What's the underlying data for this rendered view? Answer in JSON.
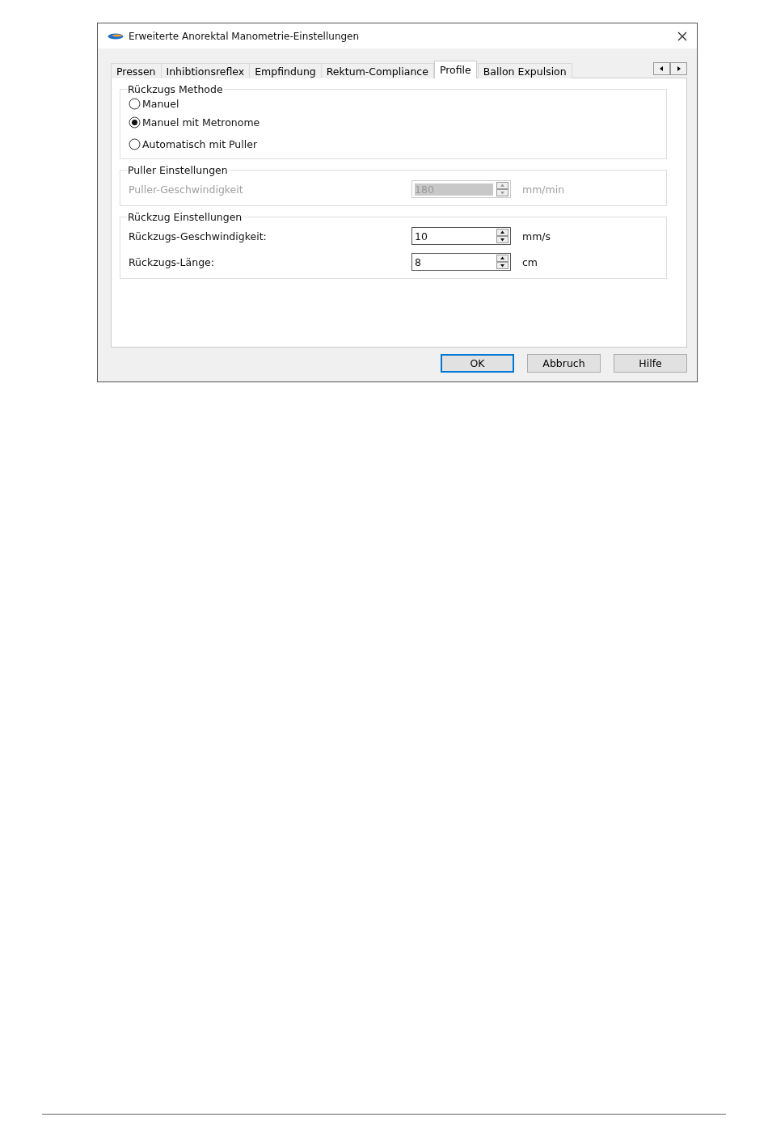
{
  "window": {
    "title": "Erweiterte Anorektal Manometrie-Einstellungen"
  },
  "tabs": [
    {
      "label": "Pressen",
      "selected": false
    },
    {
      "label": "Inhibtionsreflex",
      "selected": false
    },
    {
      "label": "Empfindung",
      "selected": false
    },
    {
      "label": "Rektum-Compliance",
      "selected": false
    },
    {
      "label": "Profile",
      "selected": true
    },
    {
      "label": "Ballon Expulsion",
      "selected": false
    }
  ],
  "groups": [
    {
      "title": "Rückzugs Methode",
      "kind": "radio",
      "options": [
        {
          "label": "Manuel",
          "selected": false
        },
        {
          "label": "Manuel mit Metronome",
          "selected": true
        },
        {
          "label": "Automatisch mit Puller",
          "selected": false
        }
      ]
    },
    {
      "title": "Puller Einstellungen",
      "kind": "fields",
      "fields": [
        {
          "label": "Puller-Geschwindigkeit",
          "value": "180",
          "unit": "mm/min",
          "disabled": true
        }
      ]
    },
    {
      "title": "Rückzug Einstellungen",
      "kind": "fields",
      "fields": [
        {
          "label": "Rückzugs-Geschwindigkeit:",
          "value": "10",
          "unit": "mm/s",
          "disabled": false
        },
        {
          "label": "Rückzugs-Länge:",
          "value": "8",
          "unit": "cm",
          "disabled": false
        }
      ]
    }
  ],
  "buttons": [
    {
      "label": "OK",
      "default": true
    },
    {
      "label": "Abbruch",
      "default": false
    },
    {
      "label": "Hilfe",
      "default": false
    }
  ]
}
